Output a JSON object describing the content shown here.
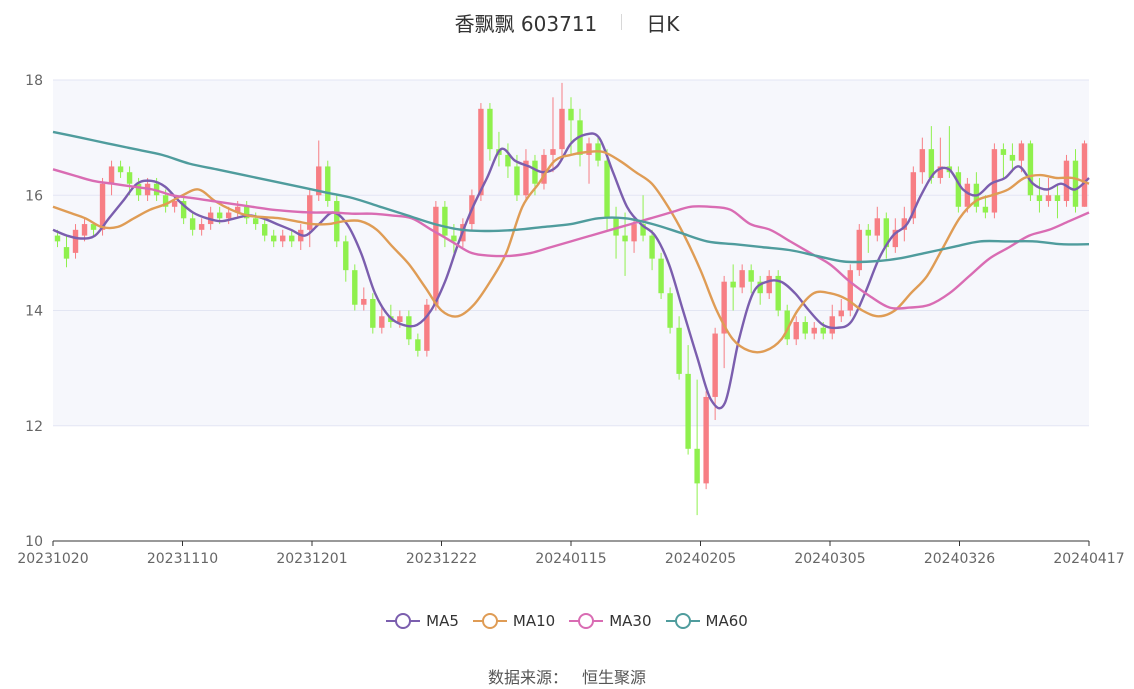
{
  "header": {
    "stock": "香飘飘 603711",
    "period": "日K"
  },
  "source": {
    "label": "数据来源：",
    "value": "恒生聚源"
  },
  "colors": {
    "up": "#f77e84",
    "down": "#8ff04d",
    "MA5": "#7b5eae",
    "MA10": "#df9c55",
    "MA30": "#d96cb3",
    "MA60": "#4f9c9d"
  },
  "chart_data": {
    "type": "candlestick",
    "title": "香飘飘 603711",
    "period": "日K",
    "ylim": [
      10,
      18
    ],
    "yticks": [
      "10",
      "12",
      "14",
      "16",
      "18"
    ],
    "xticks": [
      "20231020",
      "20231110",
      "20231201",
      "20231222",
      "20240115",
      "20240205",
      "20240305",
      "20240326",
      "20240417"
    ],
    "legend_position": "bottom",
    "grid": true,
    "candles_ohlc_approx": [
      [
        15.3,
        15.2,
        15.4,
        15.1
      ],
      [
        15.1,
        14.9,
        15.3,
        14.75
      ],
      [
        15.0,
        15.4,
        15.5,
        14.9
      ],
      [
        15.3,
        15.5,
        15.6,
        15.2
      ],
      [
        15.5,
        15.4,
        15.5,
        15.3
      ],
      [
        15.4,
        16.2,
        16.3,
        15.3
      ],
      [
        16.2,
        16.5,
        16.6,
        16.0
      ],
      [
        16.5,
        16.4,
        16.6,
        16.3
      ],
      [
        16.4,
        16.2,
        16.5,
        16.0
      ],
      [
        16.2,
        16.0,
        16.3,
        15.9
      ],
      [
        16.0,
        16.2,
        16.3,
        15.9
      ],
      [
        16.2,
        16.0,
        16.3,
        15.9
      ],
      [
        16.0,
        15.8,
        16.1,
        15.7
      ],
      [
        15.8,
        15.9,
        16.0,
        15.7
      ],
      [
        15.9,
        15.6,
        16.0,
        15.5
      ],
      [
        15.6,
        15.4,
        15.7,
        15.3
      ],
      [
        15.4,
        15.5,
        15.6,
        15.3
      ],
      [
        15.5,
        15.7,
        15.8,
        15.4
      ],
      [
        15.7,
        15.6,
        15.8,
        15.5
      ],
      [
        15.6,
        15.7,
        15.8,
        15.5
      ],
      [
        15.7,
        15.8,
        15.9,
        15.6
      ],
      [
        15.8,
        15.6,
        15.9,
        15.5
      ],
      [
        15.6,
        15.5,
        15.7,
        15.4
      ],
      [
        15.5,
        15.3,
        15.6,
        15.2
      ],
      [
        15.3,
        15.2,
        15.4,
        15.1
      ],
      [
        15.2,
        15.3,
        15.4,
        15.1
      ],
      [
        15.3,
        15.2,
        15.4,
        15.1
      ],
      [
        15.2,
        15.4,
        15.5,
        15.05
      ],
      [
        15.4,
        16.0,
        16.1,
        15.1
      ],
      [
        16.0,
        16.5,
        16.95,
        15.9
      ],
      [
        16.5,
        15.9,
        16.6,
        15.8
      ],
      [
        15.9,
        15.2,
        16.0,
        15.1
      ],
      [
        15.2,
        14.7,
        15.3,
        14.5
      ],
      [
        14.7,
        14.1,
        14.8,
        14.0
      ],
      [
        14.1,
        14.2,
        14.4,
        14.0
      ],
      [
        14.2,
        13.7,
        14.3,
        13.6
      ],
      [
        13.7,
        13.9,
        14.1,
        13.6
      ],
      [
        13.9,
        13.8,
        14.1,
        13.7
      ],
      [
        13.8,
        13.9,
        14.0,
        13.7
      ],
      [
        13.9,
        13.5,
        14.0,
        13.4
      ],
      [
        13.5,
        13.3,
        13.6,
        13.2
      ],
      [
        13.3,
        14.1,
        14.2,
        13.2
      ],
      [
        14.1,
        15.8,
        15.9,
        14.0
      ],
      [
        15.8,
        15.3,
        15.9,
        15.1
      ],
      [
        15.3,
        15.2,
        15.5,
        15.0
      ],
      [
        15.2,
        15.5,
        15.6,
        15.1
      ],
      [
        15.5,
        16.0,
        16.1,
        15.4
      ],
      [
        16.0,
        17.5,
        17.6,
        15.9
      ],
      [
        17.5,
        16.8,
        17.6,
        16.6
      ],
      [
        16.8,
        16.7,
        17.1,
        16.5
      ],
      [
        16.7,
        16.5,
        16.9,
        16.3
      ],
      [
        16.5,
        16.0,
        16.7,
        15.9
      ],
      [
        16.0,
        16.6,
        16.8,
        15.9
      ],
      [
        16.6,
        16.2,
        16.7,
        16.0
      ],
      [
        16.2,
        16.7,
        16.8,
        16.1
      ],
      [
        16.7,
        16.8,
        17.7,
        16.4
      ],
      [
        16.8,
        17.5,
        17.95,
        16.6
      ],
      [
        17.5,
        17.3,
        17.7,
        16.7
      ],
      [
        17.3,
        16.7,
        17.5,
        16.5
      ],
      [
        16.7,
        16.9,
        17.0,
        16.2
      ],
      [
        16.9,
        16.6,
        17.0,
        16.5
      ],
      [
        16.6,
        15.6,
        16.8,
        15.4
      ],
      [
        15.6,
        15.3,
        15.8,
        14.9
      ],
      [
        15.3,
        15.2,
        15.7,
        14.6
      ],
      [
        15.2,
        15.5,
        15.6,
        15.0
      ],
      [
        15.5,
        15.3,
        16.0,
        15.2
      ],
      [
        15.3,
        14.9,
        15.4,
        14.7
      ],
      [
        14.9,
        14.3,
        15.0,
        14.2
      ],
      [
        14.3,
        13.7,
        14.4,
        13.6
      ],
      [
        13.7,
        12.9,
        13.9,
        12.8
      ],
      [
        12.9,
        11.6,
        13.4,
        11.5
      ],
      [
        11.6,
        11.0,
        12.8,
        10.45
      ],
      [
        11.0,
        12.5,
        12.6,
        10.9
      ],
      [
        12.5,
        13.6,
        13.7,
        12.1
      ],
      [
        13.6,
        14.5,
        14.6,
        13.0
      ],
      [
        14.5,
        14.4,
        14.8,
        14.0
      ],
      [
        14.4,
        14.7,
        14.8,
        14.3
      ],
      [
        14.7,
        14.5,
        14.8,
        14.3
      ],
      [
        14.5,
        14.3,
        14.6,
        14.1
      ],
      [
        14.3,
        14.6,
        14.7,
        14.2
      ],
      [
        14.6,
        14.0,
        14.7,
        13.9
      ],
      [
        14.0,
        13.5,
        14.1,
        13.4
      ],
      [
        13.5,
        13.8,
        13.9,
        13.4
      ],
      [
        13.8,
        13.6,
        13.9,
        13.5
      ],
      [
        13.6,
        13.7,
        13.8,
        13.5
      ],
      [
        13.7,
        13.6,
        13.8,
        13.5
      ],
      [
        13.6,
        13.9,
        14.1,
        13.5
      ],
      [
        13.9,
        14.0,
        14.2,
        13.8
      ],
      [
        14.0,
        14.7,
        14.8,
        13.9
      ],
      [
        14.7,
        15.4,
        15.5,
        14.6
      ],
      [
        15.4,
        15.3,
        15.5,
        15.0
      ],
      [
        15.3,
        15.6,
        15.8,
        15.2
      ],
      [
        15.6,
        15.1,
        15.7,
        14.9
      ],
      [
        15.1,
        15.4,
        15.6,
        15.0
      ],
      [
        15.4,
        15.6,
        15.8,
        15.2
      ],
      [
        15.6,
        16.4,
        16.5,
        15.5
      ],
      [
        16.4,
        16.8,
        17.0,
        16.2
      ],
      [
        16.8,
        16.3,
        17.2,
        16.2
      ],
      [
        16.3,
        16.5,
        17.0,
        16.2
      ],
      [
        16.5,
        16.4,
        17.2,
        16.3
      ],
      [
        16.4,
        15.8,
        16.5,
        15.7
      ],
      [
        15.8,
        16.2,
        16.3,
        15.7
      ],
      [
        16.2,
        15.8,
        16.4,
        15.7
      ],
      [
        15.8,
        15.7,
        16.0,
        15.6
      ],
      [
        15.7,
        16.8,
        16.9,
        15.6
      ],
      [
        16.8,
        16.7,
        16.9,
        16.3
      ],
      [
        16.7,
        16.6,
        16.9,
        16.4
      ],
      [
        16.6,
        16.9,
        16.95,
        16.4
      ],
      [
        16.9,
        16.0,
        16.95,
        15.9
      ],
      [
        16.0,
        15.9,
        16.3,
        15.7
      ],
      [
        15.9,
        16.0,
        16.3,
        15.8
      ],
      [
        16.0,
        15.9,
        16.2,
        15.6
      ],
      [
        15.9,
        16.6,
        16.7,
        15.8
      ],
      [
        16.6,
        15.8,
        16.8,
        15.7
      ],
      [
        15.8,
        16.9,
        16.95,
        15.8
      ]
    ],
    "series": [
      {
        "name": "MA5",
        "values": [
          15.4,
          15.3,
          15.25,
          15.3,
          15.6,
          15.9,
          16.2,
          16.25,
          16.15,
          15.9,
          15.7,
          15.6,
          15.55,
          15.6,
          15.65,
          15.6,
          15.5,
          15.4,
          15.3,
          15.5,
          15.7,
          15.5,
          15.0,
          14.3,
          13.9,
          13.75,
          13.75,
          14.0,
          14.5,
          15.2,
          15.8,
          16.3,
          16.8,
          16.6,
          16.5,
          16.4,
          16.5,
          16.9,
          17.05,
          17.0,
          16.4,
          15.8,
          15.5,
          15.3,
          14.8,
          14.0,
          13.2,
          12.45,
          12.4,
          13.5,
          14.3,
          14.5,
          14.5,
          14.3,
          14.0,
          13.75,
          13.7,
          13.8,
          14.3,
          14.9,
          15.3,
          15.5,
          16.0,
          16.4,
          16.45,
          16.1,
          16.0,
          16.2,
          16.3,
          16.5,
          16.2,
          16.1,
          16.2,
          16.1,
          16.3
        ]
      },
      {
        "name": "MA10",
        "values": [
          15.8,
          15.7,
          15.6,
          15.45,
          15.45,
          15.6,
          15.75,
          15.85,
          16.0,
          16.1,
          15.9,
          15.75,
          15.65,
          15.62,
          15.6,
          15.55,
          15.5,
          15.5,
          15.55,
          15.55,
          15.4,
          15.1,
          14.8,
          14.4,
          14.0,
          13.9,
          14.1,
          14.5,
          15.0,
          15.8,
          16.2,
          16.6,
          16.7,
          16.75,
          16.75,
          16.6,
          16.4,
          16.2,
          15.8,
          15.3,
          14.7,
          14.0,
          13.5,
          13.3,
          13.3,
          13.5,
          14.0,
          14.3,
          14.3,
          14.2,
          14.0,
          13.9,
          14.0,
          14.3,
          14.6,
          15.1,
          15.6,
          15.9,
          16.0,
          16.1,
          16.3,
          16.35,
          16.3,
          16.3,
          16.2
        ]
      },
      {
        "name": "MA30",
        "values": [
          16.45,
          16.35,
          16.25,
          16.2,
          16.15,
          16.1,
          16.0,
          15.95,
          15.9,
          15.85,
          15.8,
          15.75,
          15.72,
          15.7,
          15.7,
          15.68,
          15.68,
          15.65,
          15.6,
          15.4,
          15.2,
          15.0,
          14.95,
          14.95,
          15.0,
          15.1,
          15.2,
          15.3,
          15.4,
          15.5,
          15.6,
          15.7,
          15.8,
          15.8,
          15.75,
          15.5,
          15.4,
          15.2,
          15.0,
          14.8,
          14.5,
          14.25,
          14.05,
          14.05,
          14.1,
          14.3,
          14.6,
          14.9,
          15.1,
          15.3,
          15.4,
          15.55,
          15.7
        ]
      },
      {
        "name": "MA60",
        "values": [
          17.1,
          17.0,
          16.9,
          16.8,
          16.7,
          16.55,
          16.45,
          16.35,
          16.25,
          16.15,
          16.05,
          15.95,
          15.8,
          15.65,
          15.5,
          15.4,
          15.38,
          15.4,
          15.45,
          15.5,
          15.6,
          15.6,
          15.5,
          15.35,
          15.2,
          15.15,
          15.1,
          15.05,
          14.95,
          14.85,
          14.85,
          14.9,
          15.0,
          15.1,
          15.2,
          15.2,
          15.2,
          15.15,
          15.15
        ]
      }
    ]
  }
}
